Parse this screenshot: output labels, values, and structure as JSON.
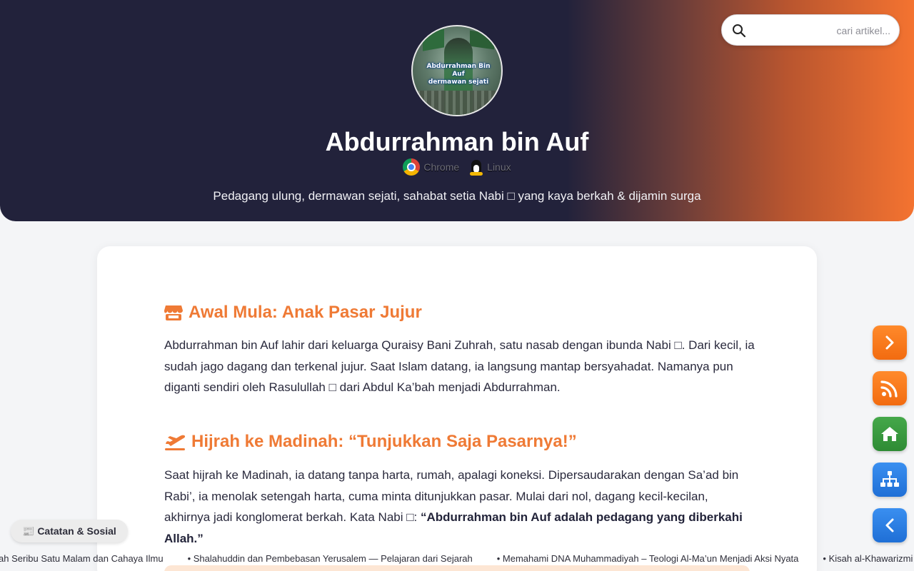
{
  "header": {
    "avatar_caption_line1": "Abdurrahman Bin Auf",
    "avatar_caption_line2": "dermawan sejati",
    "title": "Abdurrahman bin Auf",
    "env": [
      {
        "label": "Chrome",
        "icon": "chrome-icon"
      },
      {
        "label": "Linux",
        "icon": "linux-icon"
      }
    ],
    "subtitle": "Pedagang ulung, dermawan sejati, sahabat setia Nabi □ yang kaya berkah & dijamin surga"
  },
  "search": {
    "placeholder": "cari artikel...",
    "icon": "search-icon"
  },
  "article": {
    "sections": [
      {
        "icon": "store-icon",
        "title": "Awal Mula: Anak Pasar Jujur",
        "paragraph": "Abdurrahman bin Auf lahir dari keluarga Quraisy Bani Zuhrah, satu nasab dengan ibunda Nabi □. Dari kecil, ia sudah jago dagang dan terkenal jujur. Saat Islam datang, ia langsung mantap bersyahadat. Namanya pun diganti sendiri oleh Rasulullah □ dari Abdul Ka’bah menjadi Abdurrahman."
      },
      {
        "icon": "plane-departure-icon",
        "title": "Hijrah ke Madinah: “Tunjukkan Saja Pasarnya!”",
        "paragraph": "Saat hijrah ke Madinah, ia datang tanpa harta, rumah, apalagi koneksi. Dipersaudarakan dengan Sa’ad bin Rabi’, ia menolak setengah harta, cuma minta ditunjukkan pasar. Mulai dari nol, dagang kecil-kecilan, akhirnya jadi konglomerat berkah. Kata Nabi □:",
        "quote": "“Abdurrahman bin Auf adalah pedagang yang diberkahi Allah.”"
      }
    ]
  },
  "floating_buttons": [
    {
      "name": "next-button",
      "icon": "chevron-right-icon",
      "color": "#f47a1f"
    },
    {
      "name": "rss-button",
      "icon": "rss-icon",
      "color": "#f47a1f"
    },
    {
      "name": "home-button",
      "icon": "home-icon",
      "color": "#3a9a40"
    },
    {
      "name": "sitemap-button",
      "icon": "sitemap-icon",
      "color": "#2a7de3"
    },
    {
      "name": "prev-button",
      "icon": "chevron-left-icon",
      "color": "#2a7de3"
    }
  ],
  "catatan_label": {
    "icon": "newspaper-icon",
    "text": "📰 Catatan & Sosial"
  },
  "ticker": [
    "Kisah Seribu Satu Malam dan Cahaya Ilmu",
    "• Shalahuddin dan Pembebasan Yerusalem — Pelajaran dari Sejarah",
    "• Memahami DNA Muhammadiyah – Teologi Al-Ma’un Menjadi Aksi Nyata",
    "• Kisah al-Khawarizmi"
  ],
  "colors": {
    "header_dark": "#22223b",
    "header_accent": "#f47330",
    "heading": "#ef7a35"
  }
}
